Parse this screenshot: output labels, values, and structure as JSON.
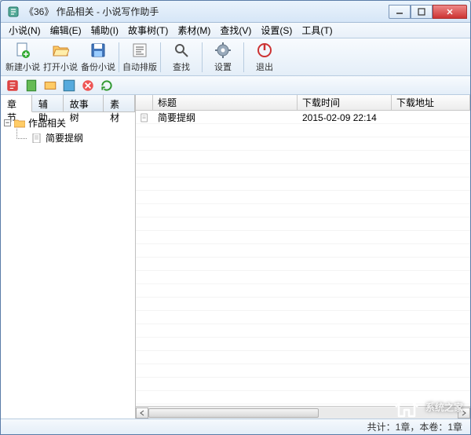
{
  "window": {
    "title": "《36》 作品相关 - 小说写作助手"
  },
  "menu": [
    {
      "label": "小说(N)"
    },
    {
      "label": "编辑(E)"
    },
    {
      "label": "辅助(I)"
    },
    {
      "label": "故事树(T)"
    },
    {
      "label": "素材(M)"
    },
    {
      "label": "查找(V)"
    },
    {
      "label": "设置(S)"
    },
    {
      "label": "工具(T)"
    }
  ],
  "toolbar": {
    "new": "新建小说",
    "open": "打开小说",
    "backup": "备份小说",
    "auto": "自动排版",
    "find": "查找",
    "settings": "设置",
    "exit": "退出"
  },
  "sidebar": {
    "tabs": [
      "章节",
      "辅助",
      "故事树",
      "素材"
    ],
    "activeTab": 0,
    "tree": {
      "root": {
        "label": "作品相关",
        "expanded": true
      },
      "child": {
        "label": "简要提纲"
      }
    }
  },
  "grid": {
    "headers": {
      "c1": "标题",
      "c2": "下载时间",
      "c3": "下载地址"
    },
    "rows": [
      {
        "title": "简要提纲",
        "time": "2015-02-09 22:14",
        "addr": ""
      }
    ]
  },
  "statusbar": {
    "text": "共计：1章，本卷：1章"
  },
  "watermark": {
    "text": "系统之家"
  }
}
